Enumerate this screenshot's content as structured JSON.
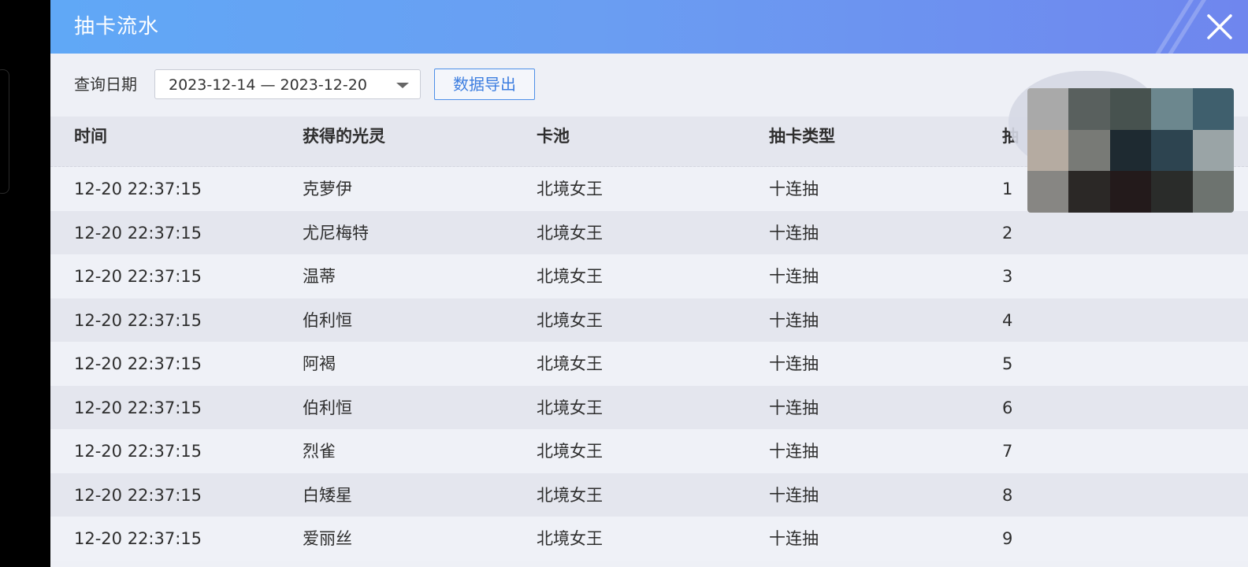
{
  "dialog": {
    "title": "抽卡流水"
  },
  "toolbar": {
    "query_label": "查询日期",
    "date_range": "2023-12-14 — 2023-12-20",
    "export_label": "数据导出"
  },
  "table": {
    "headers": [
      "时间",
      "获得的光灵",
      "卡池",
      "抽卡类型",
      "抽"
    ],
    "rows": [
      [
        "12-20 22:37:15",
        "克萝伊",
        "北境女王",
        "十连抽",
        "1"
      ],
      [
        "12-20 22:37:15",
        "尤尼梅特",
        "北境女王",
        "十连抽",
        "2"
      ],
      [
        "12-20 22:37:15",
        "温蒂",
        "北境女王",
        "十连抽",
        "3"
      ],
      [
        "12-20 22:37:15",
        "伯利恒",
        "北境女王",
        "十连抽",
        "4"
      ],
      [
        "12-20 22:37:15",
        "阿褐",
        "北境女王",
        "十连抽",
        "5"
      ],
      [
        "12-20 22:37:15",
        "伯利恒",
        "北境女王",
        "十连抽",
        "6"
      ],
      [
        "12-20 22:37:15",
        "烈雀",
        "北境女王",
        "十连抽",
        "7"
      ],
      [
        "12-20 22:37:15",
        "白矮星",
        "北境女王",
        "十连抽",
        "8"
      ],
      [
        "12-20 22:37:15",
        "爱丽丝",
        "北境女王",
        "十连抽",
        "9"
      ]
    ]
  },
  "icons": {
    "close": "close-icon",
    "dropdown": "chevron-down-icon"
  },
  "colors": {
    "header_gradient_start": "#60a8f6",
    "header_gradient_end": "#6f86ee",
    "accent": "#3d7ee0",
    "row_light": "#eff1f7",
    "row_dark": "#e4e6ee"
  },
  "mosaic_colors": [
    "#a9a9a9",
    "#59605e",
    "#47524f",
    "#6c878e",
    "#3f5f6d",
    "#b5aba1",
    "#787a76",
    "#1e2a31",
    "#2d4450",
    "#9aa4a6",
    "#878683",
    "#2b2826",
    "#231a1b",
    "#2a2c2a",
    "#6d736f"
  ]
}
